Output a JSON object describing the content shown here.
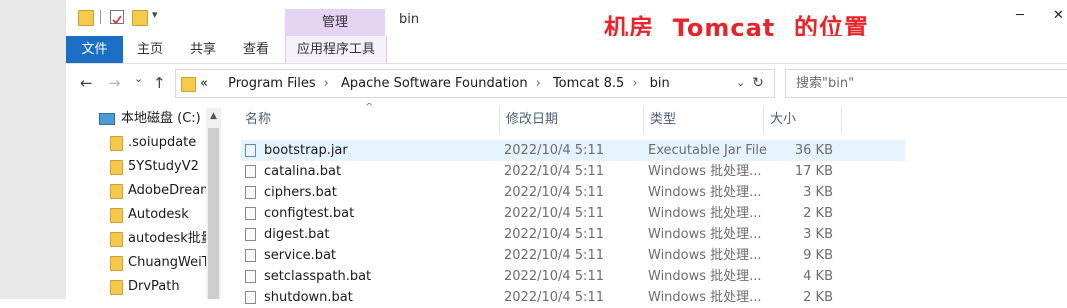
{
  "titlebar": {
    "context_tab_label": "管理",
    "window_title": "bin",
    "headline": "机房  Tomcat  的位置",
    "qa_divider": "|",
    "qa_dropdown": "▾",
    "minimize": "─",
    "close": "✕"
  },
  "ribbon": {
    "tabs": [
      "文件",
      "主页",
      "共享",
      "查看",
      "应用程序工具"
    ]
  },
  "nav": {
    "back": "←",
    "forward": "→",
    "recent": "⌄",
    "up": "↑"
  },
  "address": {
    "crumbs": [
      "«",
      "Program Files",
      "Apache Software Foundation",
      "Tomcat 8.5",
      "bin"
    ],
    "separator": "›",
    "dropdown": "⌄",
    "refresh": "↻"
  },
  "search": {
    "placeholder": "搜索\"bin\""
  },
  "nav_pane": {
    "this_pc": "本地磁盘 (C:)",
    "scroll_up": "▲",
    "folders": [
      ".soiupdate",
      "5YStudyV2",
      "AdobeDream",
      "Autodesk",
      "autodesk批量",
      "ChuangWeiTe",
      "DrvPath"
    ]
  },
  "columns": {
    "sort_indicator": "^",
    "name": "名称",
    "date": "修改日期",
    "type": "类型",
    "size": "大小"
  },
  "files": [
    {
      "name": "bootstrap.jar",
      "date": "2022/10/4 5:11",
      "type": "Executable Jar File",
      "size": "36 KB"
    },
    {
      "name": "catalina.bat",
      "date": "2022/10/4 5:11",
      "type": "Windows 批处理...",
      "size": "17 KB"
    },
    {
      "name": "ciphers.bat",
      "date": "2022/10/4 5:11",
      "type": "Windows 批处理...",
      "size": "3 KB"
    },
    {
      "name": "configtest.bat",
      "date": "2022/10/4 5:11",
      "type": "Windows 批处理...",
      "size": "2 KB"
    },
    {
      "name": "digest.bat",
      "date": "2022/10/4 5:11",
      "type": "Windows 批处理...",
      "size": "3 KB"
    },
    {
      "name": "service.bat",
      "date": "2022/10/4 5:11",
      "type": "Windows 批处理...",
      "size": "9 KB"
    },
    {
      "name": "setclasspath.bat",
      "date": "2022/10/4 5:11",
      "type": "Windows 批处理...",
      "size": "4 KB"
    },
    {
      "name": "shutdown.bat",
      "date": "2022/10/4 5:11",
      "type": "Windows 批处理...",
      "size": "2 KB"
    }
  ],
  "colors": {
    "accent": "#1a6fc4",
    "context_tab": "#e4d3f3",
    "headline": "#e8232a",
    "selection": "#e5f3ff"
  }
}
